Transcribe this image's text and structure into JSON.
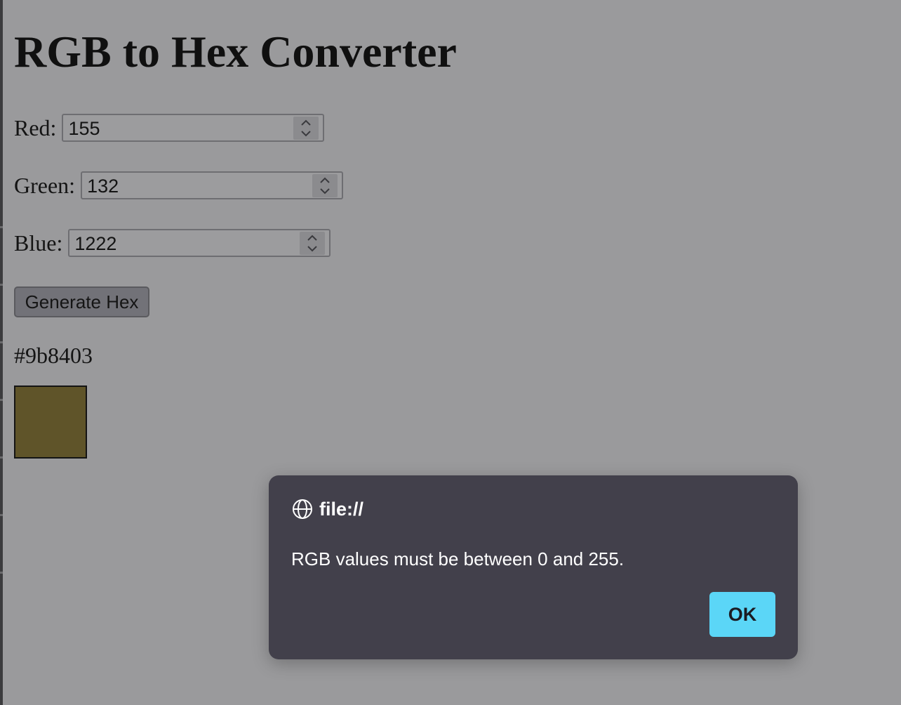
{
  "page": {
    "title": "RGB to Hex Converter"
  },
  "form": {
    "red": {
      "label": "Red:",
      "value": "155"
    },
    "green": {
      "label": "Green:",
      "value": "132"
    },
    "blue": {
      "label": "Blue:",
      "value": "1222"
    },
    "generate_label": "Generate Hex"
  },
  "result": {
    "hex_text": "#9b8403",
    "swatch_color": "#5f5429"
  },
  "dialog": {
    "origin": "file://",
    "message": "RGB values must be between 0 and 255.",
    "ok_label": "OK",
    "background_color": "#42404b",
    "ok_color": "#5bd6f7"
  },
  "icons": {
    "origin_icon": "globe-icon",
    "spinner_icon": "chevron-up-down-icon"
  }
}
